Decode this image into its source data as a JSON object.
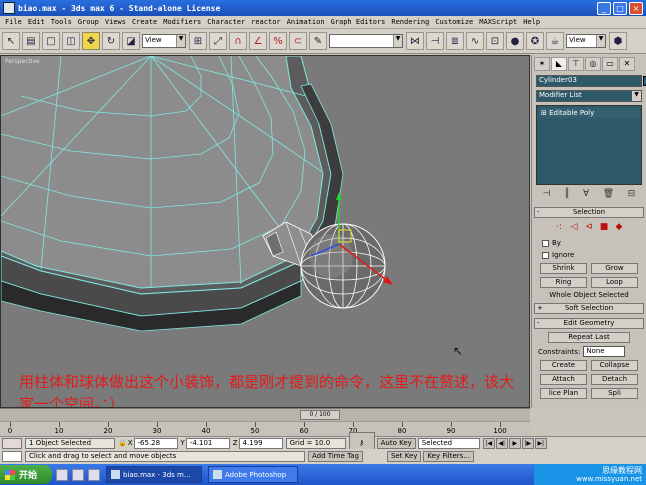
{
  "window": {
    "title": "biao.max - 3ds max 6 - Stand-alone License",
    "minimize": "_",
    "maximize": "□",
    "close": "×"
  },
  "menu": [
    "File",
    "Edit",
    "Tools",
    "Group",
    "Views",
    "Create",
    "Modifiers",
    "Character",
    "reactor",
    "Animation",
    "Graph Editors",
    "Rendering",
    "Customize",
    "MAXScript",
    "Help"
  ],
  "toolbar": {
    "ref_coord": "View",
    "named_sel": "",
    "view_drop2": "View"
  },
  "viewport": {
    "label": "Perspective",
    "colors": {
      "background": "#7a7a7a",
      "wire": "#7fe8e0",
      "selected": "#ffffff"
    }
  },
  "annotation": {
    "text": "用柱体和球体做出这个小装饰，都是刚才提到的命令，这里不在赘述，该大家一个空间。：）",
    "color": "#e51a1a"
  },
  "command_panel": {
    "object_name": "Cylinder03",
    "modifier_list": "Modifier List",
    "stack_item": "Editable Poly",
    "selection": {
      "title": "Selection",
      "by_vertex": "By",
      "ignore_backfacing": "Ignore",
      "shrink": "Shrink",
      "grow": "Grow",
      "ring": "Ring",
      "loop": "Loop",
      "status": "Whole Object Selected"
    },
    "soft_selection": {
      "title": "Soft Selection"
    },
    "edit_geometry": {
      "title": "Edit Geometry",
      "repeat_last": "Repeat Last",
      "constraints_label": "Constraints:",
      "constraints_value": "None",
      "create": "Create",
      "collapse": "Collapse",
      "attach": "Attach",
      "detach": "Detach",
      "slice_plane": "lice Plan",
      "split": "Spli"
    }
  },
  "timeline": {
    "frame_counter": "0 / 100",
    "ticks": [
      0,
      10,
      20,
      30,
      40,
      50,
      60,
      70,
      80,
      90,
      100
    ]
  },
  "status": {
    "selected_count": "1 Object Selected",
    "x_label": "X",
    "x_value": "-65.28",
    "y_label": "Y",
    "y_value": "-4.101",
    "z_label": "Z",
    "z_value": "4.199",
    "grid": "Grid = 10.0",
    "auto_key": "Auto Key",
    "auto_key_selected": "Selected",
    "prompt": "Click and drag to select and move objects",
    "add_time_tag": "Add Time Tag",
    "set_key": "Set Key",
    "key_filters": "Key Filters..."
  },
  "taskbar": {
    "start": "开始",
    "tasks": [
      "biao.max - 3ds m...",
      "Adobe Photoshop"
    ],
    "watermark_cn": "思缘教程网",
    "watermark_url": "www.missyuan.net"
  }
}
